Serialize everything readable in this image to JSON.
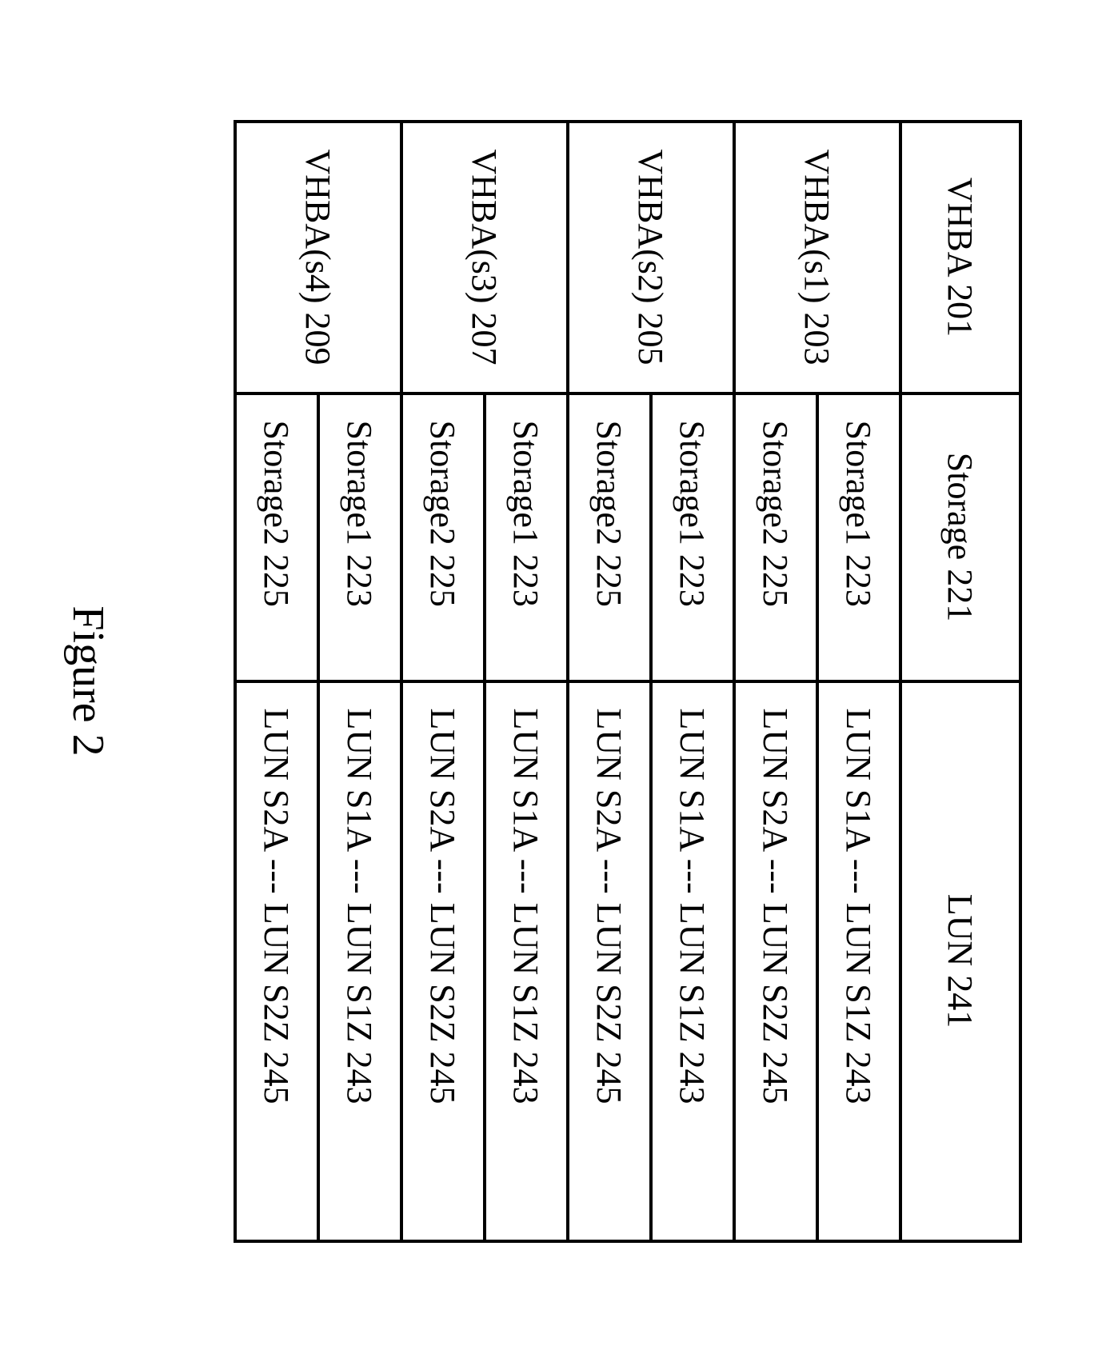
{
  "headers": {
    "vhba": "VHBA 201",
    "storage": "Storage 221",
    "lun": "LUN 241"
  },
  "rows": [
    {
      "vhba": "VHBA(s1) 203",
      "storage": "Storage1 223",
      "lun": "LUN S1A --- LUN S1Z 243"
    },
    {
      "vhba": "",
      "storage": "Storage2 225",
      "lun": "LUN S2A --- LUN S2Z 245"
    },
    {
      "vhba": "VHBA(s2) 205",
      "storage": "Storage1 223",
      "lun": "LUN S1A --- LUN S1Z 243"
    },
    {
      "vhba": "",
      "storage": "Storage2 225",
      "lun": "LUN S2A --- LUN S2Z 245"
    },
    {
      "vhba": "VHBA(s3) 207",
      "storage": "Storage1 223",
      "lun": "LUN S1A --- LUN S1Z 243"
    },
    {
      "vhba": "",
      "storage": "Storage2 225",
      "lun": "LUN S2A --- LUN S2Z 245"
    },
    {
      "vhba": "VHBA(s4) 209",
      "storage": "Storage1 223",
      "lun": "LUN S1A --- LUN S1Z 243"
    },
    {
      "vhba": "",
      "storage": "Storage2 225",
      "lun": "LUN S2A --- LUN S2Z 245"
    }
  ],
  "figure_label": "Figure 2"
}
